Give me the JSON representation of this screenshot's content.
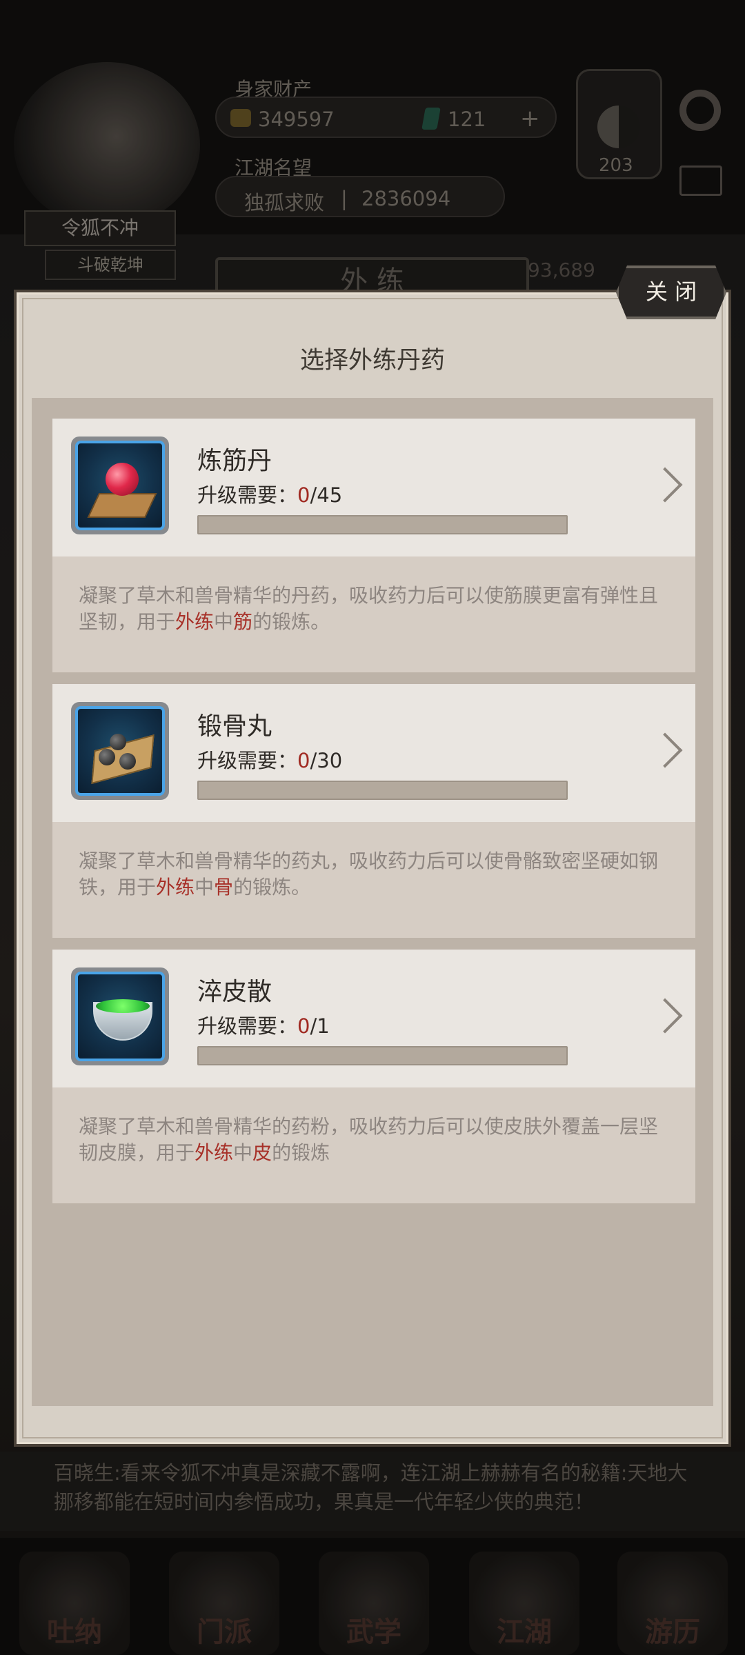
{
  "header": {
    "wealth_label": "身家财产",
    "coins": "349597",
    "jade": "121",
    "fame_label": "江湖名望",
    "title": "独孤求败",
    "fame_value": "2836094",
    "yinyang_value": "203",
    "player_name": "令狐不冲",
    "rank": "斗破乾坤",
    "side_value": "93,689"
  },
  "background": {
    "tab_label": "外 练",
    "ticker": "百晓生:看来令狐不冲真是深藏不露啊，连江湖上赫赫有名的秘籍:天地大挪移都能在短时间内参悟成功，果真是一代年轻少侠的典范！"
  },
  "nav": [
    "吐纳",
    "门派",
    "武学",
    "江湖",
    "游历"
  ],
  "dialog": {
    "title": "选择外练丹药",
    "close_label": "关 闭",
    "req_label": "升级需要：",
    "items": [
      {
        "name": "炼筋丹",
        "current": "0",
        "required": "/45",
        "progress": 0,
        "icon": "red-pill-icon",
        "desc_pre": "凝聚了草木和兽骨精华的丹药，吸收药力后可以使筋膜更富有弹性且坚韧，用于",
        "desc_hl1": "外练",
        "desc_mid": "中",
        "desc_hl2": "筋",
        "desc_post": "的锻炼。"
      },
      {
        "name": "锻骨丸",
        "current": "0",
        "required": "/30",
        "progress": 0,
        "icon": "black-pills-icon",
        "desc_pre": "凝聚了草木和兽骨精华的药丸，吸收药力后可以使骨骼致密坚硬如钢铁，用于",
        "desc_hl1": "外练",
        "desc_mid": "中",
        "desc_hl2": "骨",
        "desc_post": "的锻炼。"
      },
      {
        "name": "淬皮散",
        "current": "0",
        "required": "/1",
        "progress": 0,
        "icon": "green-powder-bowl-icon",
        "desc_pre": "凝聚了草木和兽骨精华的药粉，吸收药力后可以使皮肤外覆盖一层坚韧皮膜，用于",
        "desc_hl1": "外练",
        "desc_mid": "中",
        "desc_hl2": "皮",
        "desc_post": "的锻炼"
      }
    ]
  }
}
